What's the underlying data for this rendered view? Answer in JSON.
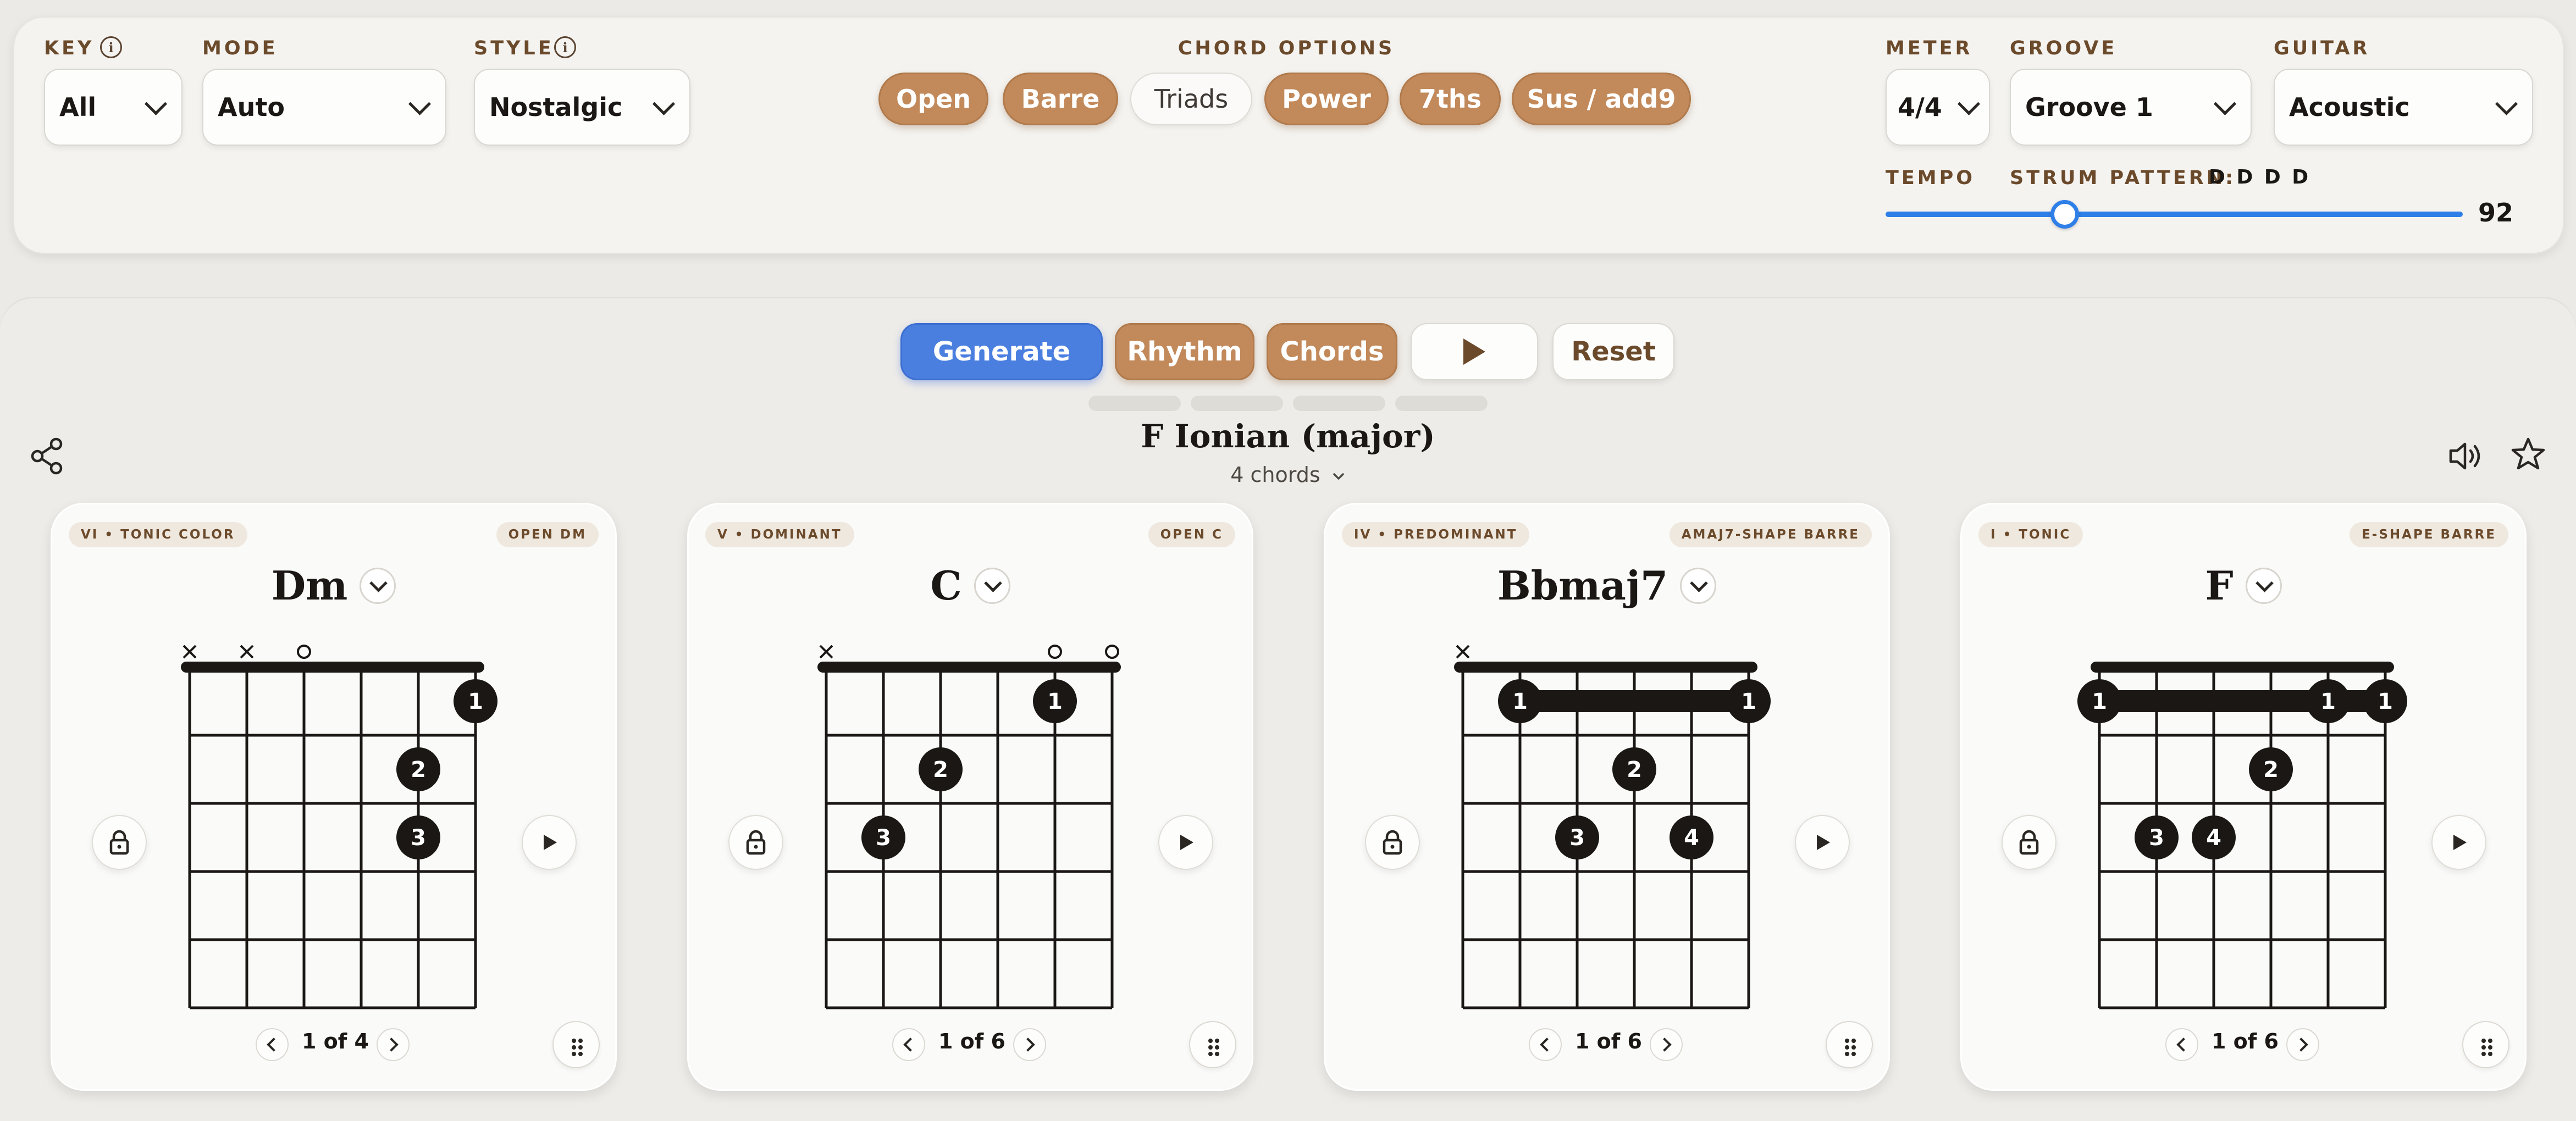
{
  "controls": {
    "key": {
      "label": "KEY",
      "value": "All"
    },
    "mode": {
      "label": "MODE",
      "value": "Auto"
    },
    "style": {
      "label": "STYLE",
      "value": "Nostalgic"
    },
    "chord_options": {
      "label": "CHORD OPTIONS",
      "items": [
        {
          "label": "Open",
          "active": true
        },
        {
          "label": "Barre",
          "active": true
        },
        {
          "label": "Triads",
          "active": false
        },
        {
          "label": "Power",
          "active": true
        },
        {
          "label": "7ths",
          "active": true
        },
        {
          "label": "Sus / add9",
          "active": true
        }
      ]
    },
    "meter": {
      "label": "METER",
      "value": "4/4"
    },
    "groove": {
      "label": "GROOVE",
      "value": "Groove 1"
    },
    "guitar": {
      "label": "GUITAR",
      "value": "Acoustic"
    },
    "tempo": {
      "label": "TEMPO",
      "value": "92",
      "fraction": 0.31
    },
    "strum": {
      "label": "STRUM PATTERN:",
      "value": "D D D D"
    },
    "info_icon": "i"
  },
  "actions": {
    "generate": "Generate",
    "rhythm": "Rhythm",
    "chords": "Chords",
    "reset": "Reset"
  },
  "progression": {
    "title": "F Ionian (major)",
    "count": "4 chords"
  },
  "icons": {
    "share": "share-icon",
    "speaker": "speaker-icon",
    "star": "star-icon"
  },
  "colors": {
    "accent_blue": "#4a7fe0",
    "brown": "#c2895a",
    "brown_text": "#6b4a2b",
    "slider": "#2f7fe8"
  },
  "cards": [
    {
      "function": "VI • TONIC COLOR",
      "shape": "OPEN DM",
      "name": "Dm",
      "pager": "1 of 4",
      "markers": [
        "x",
        "x",
        "o",
        "",
        "",
        ""
      ],
      "barres": [],
      "dots": [
        {
          "string": 6,
          "fret": 1,
          "finger": "1"
        },
        {
          "string": 5,
          "fret": 2,
          "finger": "2"
        },
        {
          "string": 5,
          "fret": 3,
          "finger": "3"
        }
      ]
    },
    {
      "function": "V • DOMINANT",
      "shape": "OPEN C",
      "name": "C",
      "pager": "1 of 6",
      "markers": [
        "x",
        "",
        "",
        "",
        "o",
        "o"
      ],
      "barres": [],
      "dots": [
        {
          "string": 5,
          "fret": 1,
          "finger": "1"
        },
        {
          "string": 3,
          "fret": 2,
          "finger": "2"
        },
        {
          "string": 2,
          "fret": 3,
          "finger": "3"
        }
      ]
    },
    {
      "function": "IV • PREDOMINANT",
      "shape": "AMAJ7-SHAPE BARRE",
      "name": "Bbmaj7",
      "pager": "1 of 6",
      "markers": [
        "x",
        "",
        "",
        "",
        "",
        ""
      ],
      "barres": [
        {
          "from": 2,
          "to": 6,
          "fret": 1
        }
      ],
      "dots": [
        {
          "string": 2,
          "fret": 1,
          "finger": "1"
        },
        {
          "string": 6,
          "fret": 1,
          "finger": "1"
        },
        {
          "string": 4,
          "fret": 2,
          "finger": "2"
        },
        {
          "string": 3,
          "fret": 3,
          "finger": "3"
        },
        {
          "string": 5,
          "fret": 3,
          "finger": "4"
        }
      ]
    },
    {
      "function": "I • TONIC",
      "shape": "E-SHAPE BARRE",
      "name": "F",
      "pager": "1 of 6",
      "markers": [
        "",
        "",
        "",
        "",
        "",
        ""
      ],
      "barres": [
        {
          "from": 1,
          "to": 6,
          "fret": 1
        }
      ],
      "dots": [
        {
          "string": 1,
          "fret": 1,
          "finger": "1"
        },
        {
          "string": 5,
          "fret": 1,
          "finger": "1"
        },
        {
          "string": 6,
          "fret": 1,
          "finger": "1"
        },
        {
          "string": 4,
          "fret": 2,
          "finger": "2"
        },
        {
          "string": 2,
          "fret": 3,
          "finger": "3"
        },
        {
          "string": 3,
          "fret": 3,
          "finger": "4"
        }
      ]
    }
  ]
}
